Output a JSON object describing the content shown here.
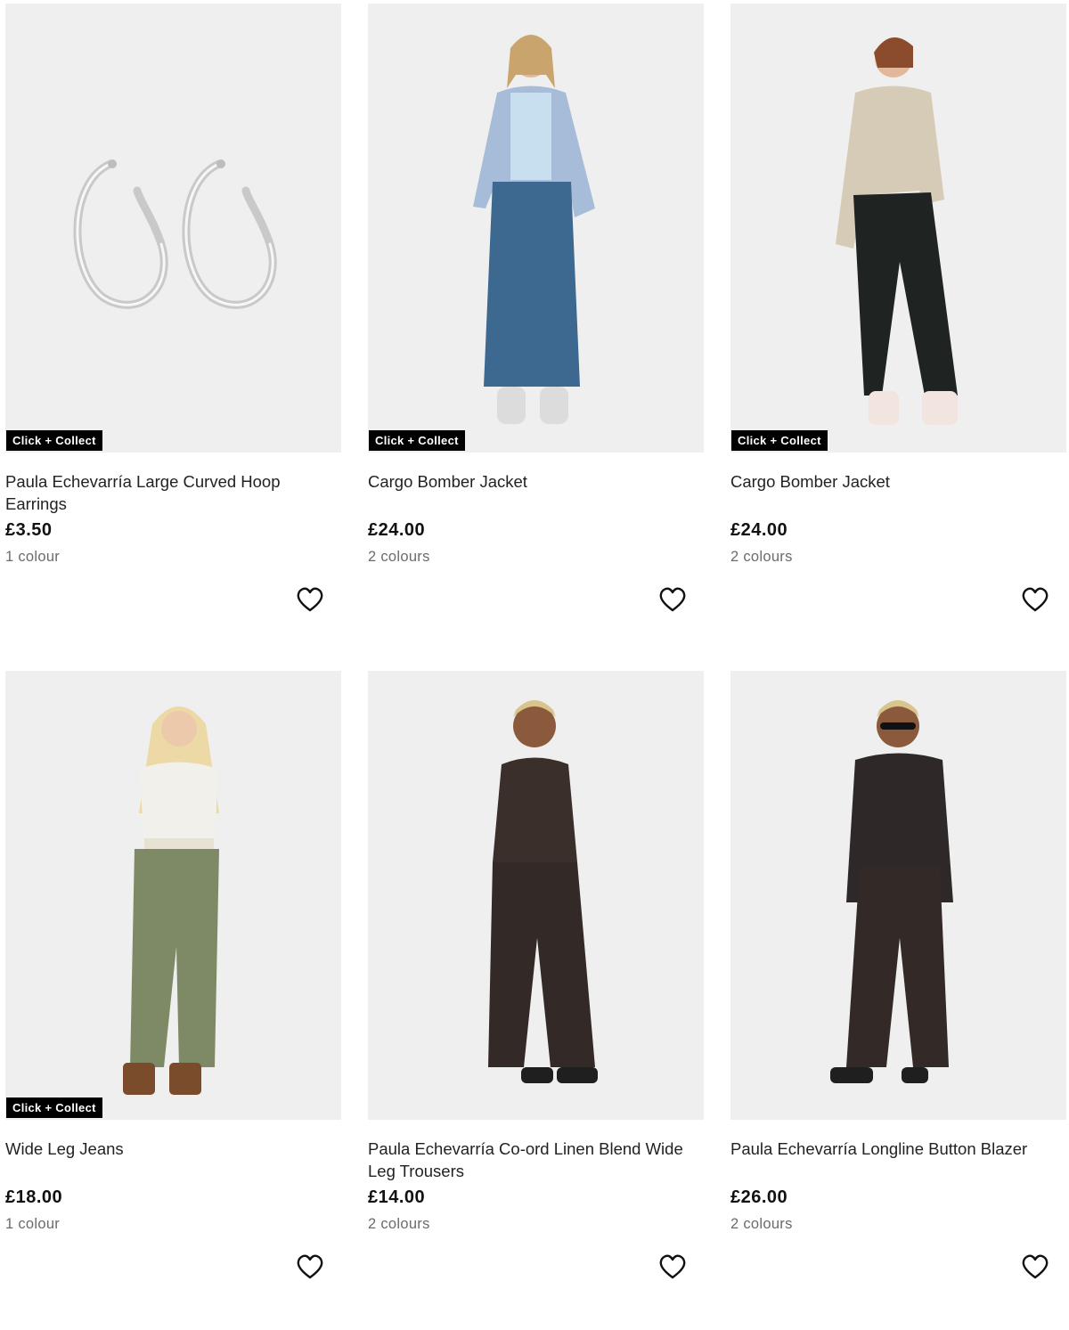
{
  "products": [
    {
      "title": "Paula Echevarría Large Curved Hoop Earrings",
      "price": "£3.50",
      "colours": "1 colour",
      "badge": "Click + Collect",
      "image": "silver-hoop-earrings"
    },
    {
      "title": "Cargo Bomber Jacket",
      "price": "£24.00",
      "colours": "2 colours",
      "badge": "Click + Collect",
      "image": "woman-blue-bomber-denim-skirt"
    },
    {
      "title": "Cargo Bomber Jacket",
      "price": "£24.00",
      "colours": "2 colours",
      "badge": "Click + Collect",
      "image": "woman-beige-bomber-black-jeans"
    },
    {
      "title": "Wide Leg Jeans",
      "price": "£18.00",
      "colours": "1 colour",
      "badge": "Click + Collect",
      "image": "woman-green-wide-leg-jeans"
    },
    {
      "title": "Paula Echevarría Co-ord Linen Blend Wide Leg Trousers",
      "price": "£14.00",
      "colours": "2 colours",
      "badge": "",
      "image": "woman-brown-waistcoat-trousers"
    },
    {
      "title": "Paula Echevarría Longline Button Blazer",
      "price": "£26.00",
      "colours": "2 colours",
      "badge": "",
      "image": "woman-brown-blazer-trousers"
    }
  ],
  "icons": {
    "wishlist": "heart-outline-icon"
  }
}
